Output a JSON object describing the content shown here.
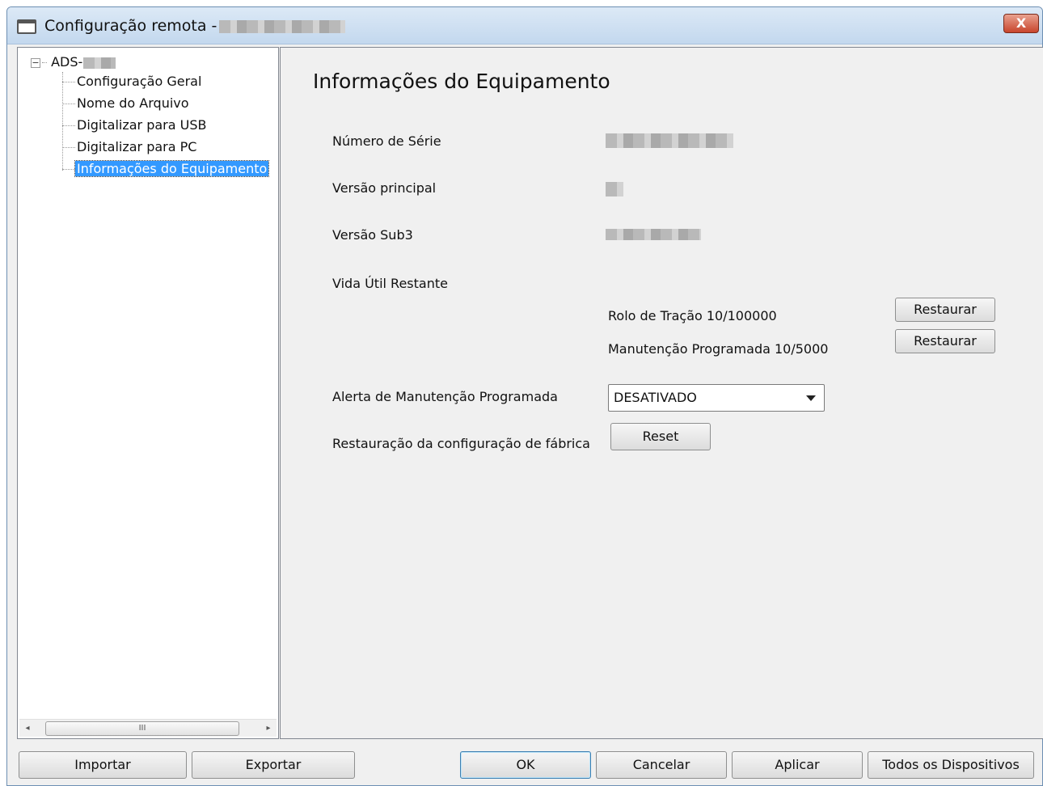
{
  "window": {
    "title": "Configuração remota -",
    "close_glyph": "X"
  },
  "tree": {
    "root_label": "ADS-",
    "expander_glyph": "−",
    "items": [
      {
        "label": "Configuração Geral"
      },
      {
        "label": "Nome do Arquivo"
      },
      {
        "label": "Digitalizar para USB"
      },
      {
        "label": "Digitalizar para PC"
      },
      {
        "label": "Informações do Equipamento",
        "selected": true
      }
    ],
    "scroll_left_glyph": "◂",
    "scroll_right_glyph": "▸",
    "scroll_grip_glyph": "III"
  },
  "content": {
    "title": "Informações do Equipamento",
    "serial_label": "Número de Série",
    "main_version_label": "Versão principal",
    "sub3_version_label": "Versão Sub3",
    "remaining_life_label": "Vida Útil Restante",
    "pick_roller": "Rolo de Tração 10/100000",
    "scheduled_maintenance": "Manutenção Programada 10/5000",
    "restore_label": "Restaurar",
    "maintenance_alert_label": "Alerta de Manutenção Programada",
    "maintenance_alert_value": "DESATIVADO",
    "factory_reset_label": "Restauração da configuração de fábrica",
    "reset_button": "Reset"
  },
  "footer": {
    "import": "Importar",
    "export": "Exportar",
    "ok": "OK",
    "cancel": "Cancelar",
    "apply": "Aplicar",
    "all_devices": "Todos os Dispositivos"
  }
}
